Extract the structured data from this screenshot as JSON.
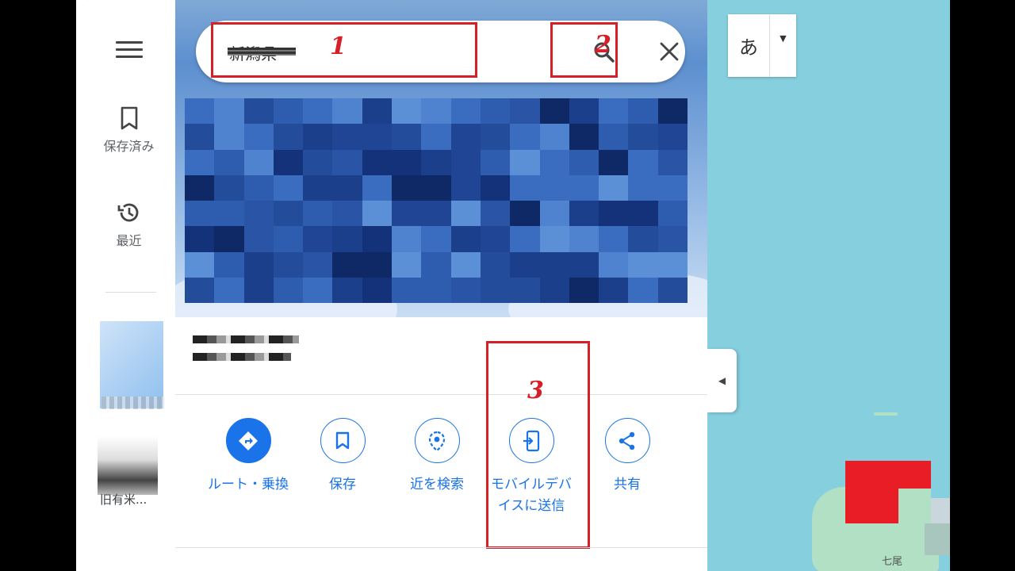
{
  "rail": {
    "saved_label": "保存済み",
    "recent_label": "最近",
    "thumb2_label": "旧有米..."
  },
  "search": {
    "query": "新潟県"
  },
  "callouts": [
    "1",
    "2",
    "3"
  ],
  "actions": [
    {
      "label": "ルート・乗換",
      "icon": "directions-icon"
    },
    {
      "label": "保存",
      "icon": "bookmark-icon"
    },
    {
      "label": "近を検索",
      "icon": "nearby-icon"
    },
    {
      "label": "モバイルデバイスに送信",
      "icon": "send-to-phone-icon"
    },
    {
      "label": "共有",
      "icon": "share-icon"
    }
  ],
  "map": {
    "language_char": "あ",
    "place_label": "七尾"
  },
  "colors": {
    "accent": "#1a73e8",
    "callout": "#d61f26",
    "water": "#86cfdf",
    "land": "#b1e0c4"
  }
}
